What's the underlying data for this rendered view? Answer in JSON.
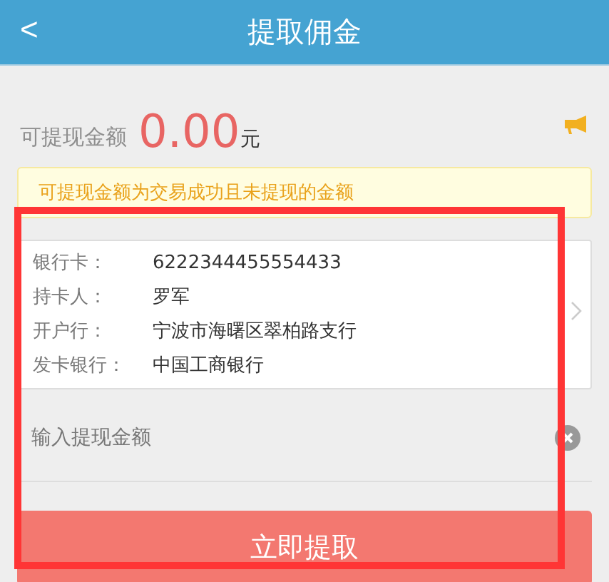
{
  "header": {
    "back": "<",
    "title": "提取佣金"
  },
  "balance": {
    "label": "可提现金额",
    "amount": "0.00",
    "unit": "元"
  },
  "notice": "可提现金额为交易成功且未提现的金额",
  "card": [
    {
      "label": "银行卡：",
      "value": "6222344455554433"
    },
    {
      "label": "持卡人：",
      "value": "罗军"
    },
    {
      "label": "开户行：",
      "value": "宁波市海曙区翠柏路支行"
    },
    {
      "label": "发卡银行：",
      "value": "中国工商银行"
    }
  ],
  "amount_field": {
    "placeholder": "输入提现金额"
  },
  "submit": "立即提取"
}
